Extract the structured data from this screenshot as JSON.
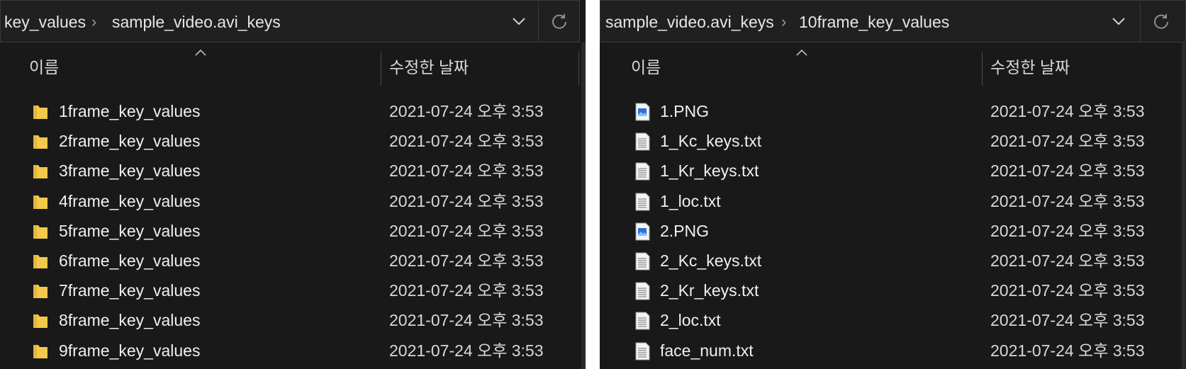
{
  "left_window": {
    "breadcrumb": [
      "key_values",
      "sample_video.avi_keys"
    ],
    "columns": {
      "name": "이름",
      "modified": "수정한 날짜"
    },
    "items": [
      {
        "name": "1frame_key_values",
        "date": "2021-07-24 오후 3:53",
        "icon": "folder-icon"
      },
      {
        "name": "2frame_key_values",
        "date": "2021-07-24 오후 3:53",
        "icon": "folder-icon"
      },
      {
        "name": "3frame_key_values",
        "date": "2021-07-24 오후 3:53",
        "icon": "folder-icon"
      },
      {
        "name": "4frame_key_values",
        "date": "2021-07-24 오후 3:53",
        "icon": "folder-icon"
      },
      {
        "name": "5frame_key_values",
        "date": "2021-07-24 오후 3:53",
        "icon": "folder-icon"
      },
      {
        "name": "6frame_key_values",
        "date": "2021-07-24 오후 3:53",
        "icon": "folder-icon"
      },
      {
        "name": "7frame_key_values",
        "date": "2021-07-24 오후 3:53",
        "icon": "folder-icon"
      },
      {
        "name": "8frame_key_values",
        "date": "2021-07-24 오후 3:53",
        "icon": "folder-icon"
      },
      {
        "name": "9frame_key_values",
        "date": "2021-07-24 오후 3:53",
        "icon": "folder-icon"
      }
    ]
  },
  "right_window": {
    "breadcrumb": [
      "sample_video.avi_keys",
      "10frame_key_values"
    ],
    "columns": {
      "name": "이름",
      "modified": "수정한 날짜"
    },
    "items": [
      {
        "name": "1.PNG",
        "date": "2021-07-24 오후 3:53",
        "icon": "image-file-icon"
      },
      {
        "name": "1_Kc_keys.txt",
        "date": "2021-07-24 오후 3:53",
        "icon": "text-file-icon"
      },
      {
        "name": "1_Kr_keys.txt",
        "date": "2021-07-24 오후 3:53",
        "icon": "text-file-icon"
      },
      {
        "name": "1_loc.txt",
        "date": "2021-07-24 오후 3:53",
        "icon": "text-file-icon"
      },
      {
        "name": "2.PNG",
        "date": "2021-07-24 오후 3:53",
        "icon": "image-file-icon"
      },
      {
        "name": "2_Kc_keys.txt",
        "date": "2021-07-24 오후 3:53",
        "icon": "text-file-icon"
      },
      {
        "name": "2_Kr_keys.txt",
        "date": "2021-07-24 오후 3:53",
        "icon": "text-file-icon"
      },
      {
        "name": "2_loc.txt",
        "date": "2021-07-24 오후 3:53",
        "icon": "text-file-icon"
      },
      {
        "name": "face_num.txt",
        "date": "2021-07-24 오후 3:53",
        "icon": "text-file-icon"
      }
    ]
  },
  "icons": {
    "dropdown": "chevron-down-icon",
    "refresh": "refresh-icon",
    "separator": "chevron-right-icon",
    "sort": "sort-ascending-icon"
  },
  "colors": {
    "background": "#191919",
    "addressbar": "#202020",
    "text": "#f0f0f0",
    "folder": "#f3c94c"
  }
}
